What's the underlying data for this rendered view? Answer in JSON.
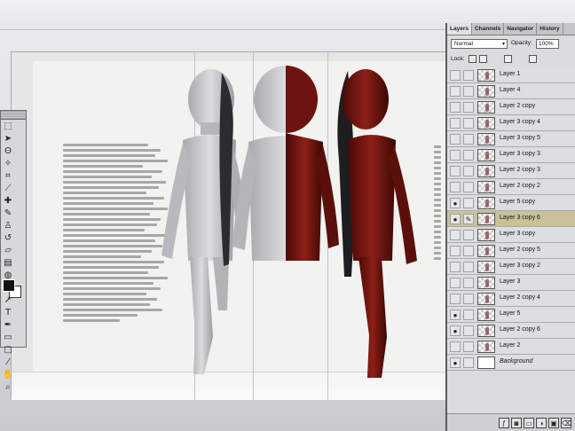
{
  "tools": {
    "items": [
      {
        "icon": "marquee-icon",
        "glyph": "⬚"
      },
      {
        "icon": "move-icon",
        "glyph": "➤"
      },
      {
        "icon": "lasso-icon",
        "glyph": "ʘ"
      },
      {
        "icon": "magic-wand-icon",
        "glyph": "✧"
      },
      {
        "icon": "crop-icon",
        "glyph": "⌗"
      },
      {
        "icon": "slice-icon",
        "glyph": "⟋"
      },
      {
        "icon": "healing-icon",
        "glyph": "✚"
      },
      {
        "icon": "brush-icon",
        "glyph": "✎"
      },
      {
        "icon": "stamp-icon",
        "glyph": "♙"
      },
      {
        "icon": "history-brush-icon",
        "glyph": "↺"
      },
      {
        "icon": "eraser-icon",
        "glyph": "▱"
      },
      {
        "icon": "gradient-icon",
        "glyph": "▤"
      },
      {
        "icon": "blur-icon",
        "glyph": "◍"
      },
      {
        "icon": "dodge-icon",
        "glyph": "◐"
      },
      {
        "icon": "path-select-icon",
        "glyph": "➚"
      },
      {
        "icon": "type-icon",
        "glyph": "T"
      },
      {
        "icon": "pen-icon",
        "glyph": "✒"
      },
      {
        "icon": "shape-icon",
        "glyph": "▭"
      },
      {
        "icon": "notes-icon",
        "glyph": "▢"
      },
      {
        "icon": "eyedropper-icon",
        "glyph": "⁄"
      },
      {
        "icon": "hand-icon",
        "glyph": "✋"
      },
      {
        "icon": "zoom-icon",
        "glyph": "⌕"
      }
    ]
  },
  "layers_panel": {
    "tabs": [
      {
        "label": "Layers",
        "active": true
      },
      {
        "label": "Channels",
        "active": false
      },
      {
        "label": "Navigator",
        "active": false
      },
      {
        "label": "History",
        "active": false
      }
    ],
    "blend_mode": "Normal",
    "opacity_label": "Opacity:",
    "opacity_value": "100%",
    "lock_label": "Lock:",
    "layers": [
      {
        "name": "Layer 1",
        "visible": false,
        "selected": false
      },
      {
        "name": "Layer 4",
        "visible": false,
        "selected": false
      },
      {
        "name": "Layer 2 copy",
        "visible": false,
        "selected": false
      },
      {
        "name": "Layer 3 copy 4",
        "visible": false,
        "selected": false
      },
      {
        "name": "Layer 3 copy 5",
        "visible": false,
        "selected": false
      },
      {
        "name": "Layer 3 copy 3",
        "visible": false,
        "selected": false
      },
      {
        "name": "Layer 2 copy 3",
        "visible": false,
        "selected": false
      },
      {
        "name": "Layer 2 copy 2",
        "visible": false,
        "selected": false
      },
      {
        "name": "Layer 5 copy",
        "visible": true,
        "selected": false
      },
      {
        "name": "Layer 3 copy 6",
        "visible": true,
        "selected": true
      },
      {
        "name": "Layer 3 copy",
        "visible": false,
        "selected": false
      },
      {
        "name": "Layer 2 copy 5",
        "visible": false,
        "selected": false
      },
      {
        "name": "Layer 3 copy 2",
        "visible": false,
        "selected": false
      },
      {
        "name": "Layer 3",
        "visible": false,
        "selected": false
      },
      {
        "name": "Layer 2 copy 4",
        "visible": false,
        "selected": false
      },
      {
        "name": "Layer 5",
        "visible": true,
        "selected": false
      },
      {
        "name": "Layer 2 copy 6",
        "visible": true,
        "selected": false
      },
      {
        "name": "Layer 2",
        "visible": false,
        "selected": false
      },
      {
        "name": "Background",
        "visible": true,
        "selected": false,
        "italic": true
      }
    ],
    "footer_icons": [
      "layer-style-icon",
      "mask-icon",
      "new-set-icon",
      "adjustment-layer-icon",
      "new-layer-icon",
      "trash-icon"
    ]
  },
  "colors": {
    "doll_light": "#c9cacc",
    "doll_red": "#7c1712",
    "selected_layer": "#c8c19a"
  }
}
